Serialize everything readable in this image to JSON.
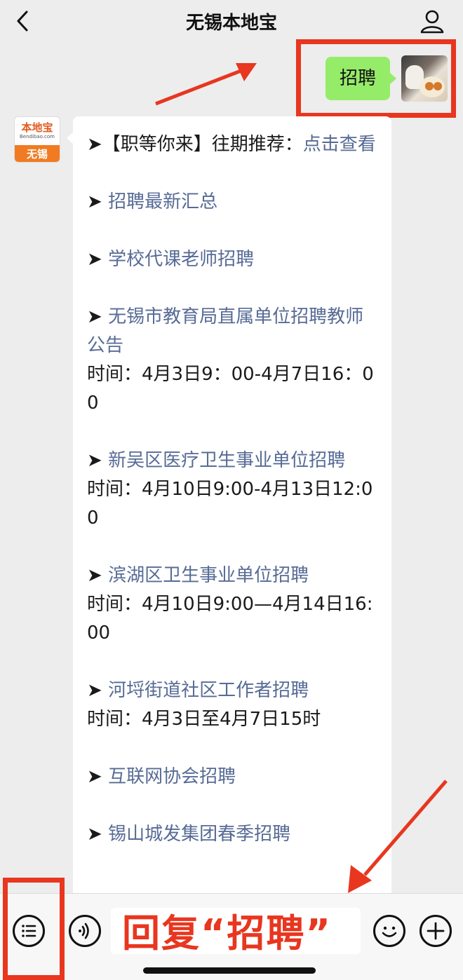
{
  "header": {
    "title": "无锡本地宝"
  },
  "sent_message": {
    "text": "招聘"
  },
  "official_avatar": {
    "brand": "本地宝",
    "site": "Bendibao.com",
    "city": "无锡"
  },
  "message": {
    "l1_prefix": "➤【职等你来】往期推荐：",
    "l1_link": "点击查看",
    "l2": "招聘最新汇总",
    "l3": "学校代课老师招聘",
    "l4": "无锡市教育局直属单位招聘教师公告",
    "l4_time": "时间：4月3日9：00-4月7日16：00",
    "l5": "新吴区医疗卫生事业单位招聘",
    "l5_time": "时间：4月10日9:00-4月13日12:00",
    "l6": "滨湖区卫生事业单位招聘",
    "l6_time": "时间：4月10日9:00—4月14日16:00",
    "l7": "河埒街道社区工作者招聘",
    "l7_time": "时间：4月3日至4月7日15时",
    "l8": "互联网协会招聘",
    "l9": "锡山城发集团春季招聘"
  },
  "arrow_glyph": "➤",
  "input": {
    "overlay_text": "回复“招聘”"
  },
  "colors": {
    "accent": "#e8361f",
    "bubble_green": "#95ec69",
    "link": "#576b95"
  },
  "icons": [
    "back-icon",
    "profile-icon",
    "menu-list-icon",
    "voice-icon",
    "emoji-icon",
    "plus-icon"
  ]
}
